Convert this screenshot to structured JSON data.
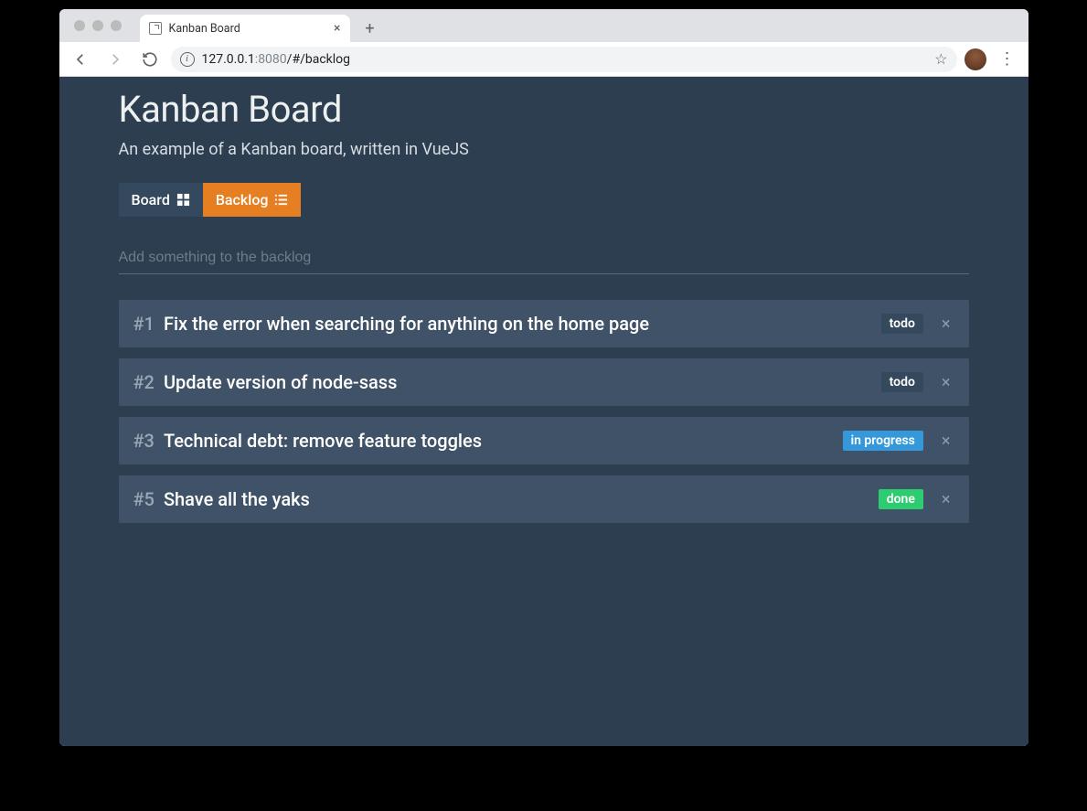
{
  "browser": {
    "tab_title": "Kanban Board",
    "url_host": "127.0.0.1",
    "url_port": ":8080",
    "url_path": "/#/backlog"
  },
  "header": {
    "title": "Kanban Board",
    "subtitle": "An example of a Kanban board, written in VueJS"
  },
  "tabs": {
    "board_label": "Board",
    "backlog_label": "Backlog"
  },
  "input": {
    "placeholder": "Add something to the backlog"
  },
  "status_labels": {
    "todo": "todo",
    "in_progress": "in progress",
    "done": "done"
  },
  "items": [
    {
      "id": "#1",
      "title": "Fix the error when searching for anything on the home page",
      "status": "todo"
    },
    {
      "id": "#2",
      "title": "Update version of node-sass",
      "status": "todo"
    },
    {
      "id": "#3",
      "title": "Technical debt: remove feature toggles",
      "status": "in_progress"
    },
    {
      "id": "#5",
      "title": "Shave all the yaks",
      "status": "done"
    }
  ]
}
